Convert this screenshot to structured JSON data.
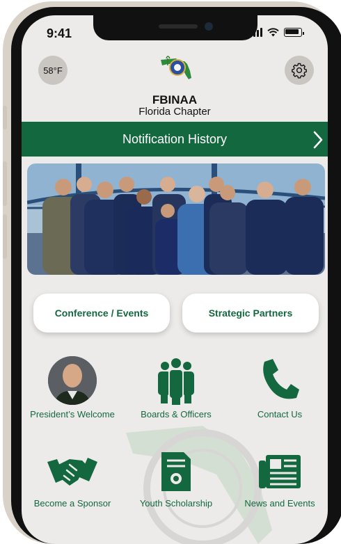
{
  "status": {
    "time": "9:41"
  },
  "weather": {
    "temperature": "58°F"
  },
  "header": {
    "title": "FBINAA",
    "subtitle": "Florida Chapter"
  },
  "notification_bar": {
    "label": "Notification History"
  },
  "buttons": {
    "conference": "Conference / Events",
    "partners": "Strategic Partners"
  },
  "tiles": [
    {
      "label": "President’s Welcome",
      "icon": "president-photo"
    },
    {
      "label": "Boards & Officers",
      "icon": "group-icon"
    },
    {
      "label": "Contact Us",
      "icon": "phone-icon"
    },
    {
      "label": "Become a Sponsor",
      "icon": "handshake-icon"
    },
    {
      "label": "Youth Scholarship",
      "icon": "certificate-icon"
    },
    {
      "label": "News and Events",
      "icon": "newspaper-icon"
    }
  ],
  "colors": {
    "brand_green": "#13683f",
    "background": "#ecebe9"
  }
}
